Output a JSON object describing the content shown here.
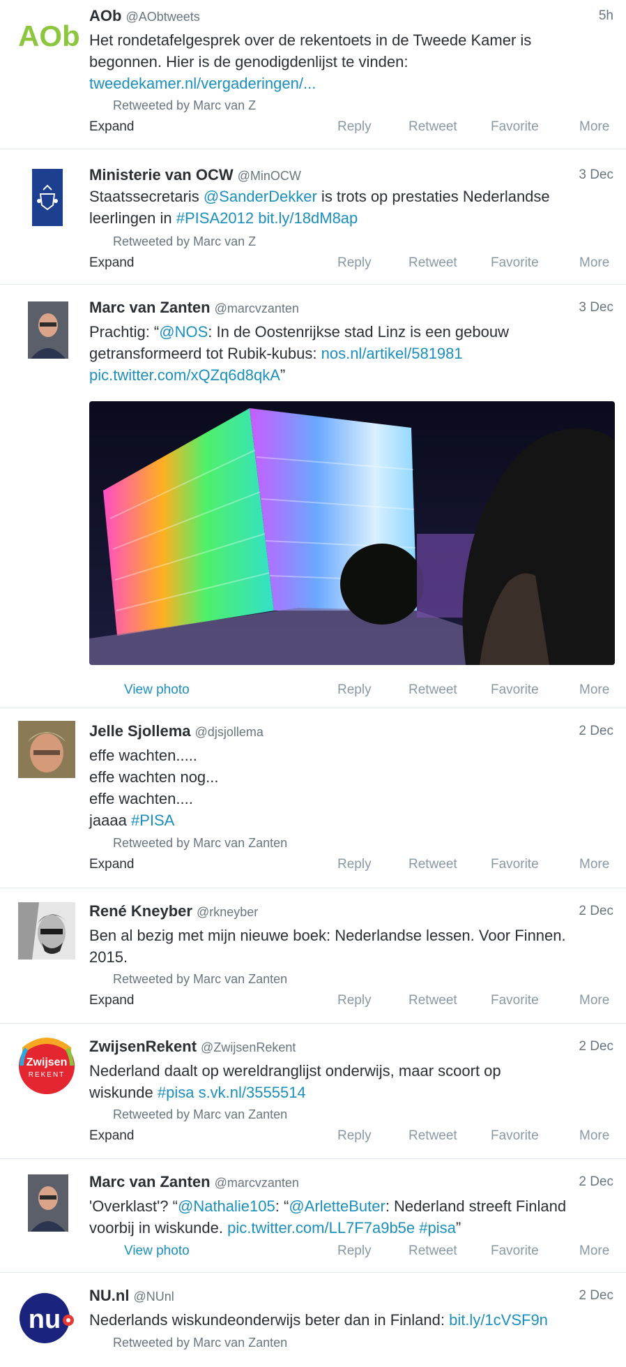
{
  "actions": {
    "expand": "Expand",
    "reply": "Reply",
    "retweet": "Retweet",
    "favorite": "Favorite",
    "more": "More",
    "view_photo": "View photo"
  },
  "tweets": [
    {
      "name": "AOb",
      "handle": "@AObtweets",
      "time": "5h",
      "text": [
        "Het rondetafelgesprek over de rekentoets in de Tweede Kamer is",
        "begonnen. Hier is de genodigdenlijst te vinden:"
      ],
      "link": "tweedekamer.nl/vergaderingen/...",
      "retweeted_by": "Retweeted by Marc van Z"
    },
    {
      "name": "Ministerie van OCW",
      "handle": "@MinOCW",
      "time": "3 Dec",
      "text1": "Staatssecretaris ",
      "mention": "@SanderDekker",
      "text2": " is trots op prestaties Nederlandse",
      "text3": "leerlingen in ",
      "hashtag": "#PISA2012",
      "link": "bit.ly/18dM8ap",
      "retweeted_by": "Retweeted by Marc van Z"
    },
    {
      "name": "Marc van Zanten",
      "handle": "@marcvzanten",
      "time": "3 Dec",
      "text1": "Prachtig: “",
      "mention": "@NOS",
      "text2": ": In de Oostenrijkse stad Linz is een gebouw",
      "text3": "getransformeerd tot Rubik-kubus: ",
      "link": "nos.nl/artikel/581981",
      "link2": "pic.twitter.com/xQZq6d8qkA",
      "text4": "”"
    },
    {
      "name": "Jelle Sjollema",
      "handle": "@djsjollema",
      "time": "2 Dec",
      "lines": [
        "effe wachten.....",
        "effe wachten nog...",
        "effe wachten...."
      ],
      "text1": "jaaaa ",
      "hashtag": "#PISA",
      "retweeted_by": "Retweeted by Marc van Zanten"
    },
    {
      "name": "René Kneyber",
      "handle": "@rkneyber",
      "time": "2 Dec",
      "lines": [
        "Ben al bezig met mijn nieuwe boek: Nederlandse lessen. Voor Finnen.",
        "2015."
      ],
      "retweeted_by": "Retweeted by Marc van Zanten"
    },
    {
      "name": "ZwijsenRekent",
      "handle": "@ZwijsenRekent",
      "time": "2 Dec",
      "text1": "Nederland daalt op wereldranglijst onderwijs, maar scoort op",
      "text2": "wiskunde ",
      "hashtag": "#pisa",
      "link": "s.vk.nl/3555514",
      "retweeted_by": "Retweeted by Marc van Zanten",
      "logo_top": "Zwijsen",
      "logo_bottom": "REKENT"
    },
    {
      "name": "Marc van Zanten",
      "handle": "@marcvzanten",
      "time": "2 Dec",
      "text1": "'Overklast'? “",
      "mention": "@Nathalie105",
      "text2": ": “",
      "mention2": "@ArletteButer",
      "text3": ": Nederland streeft Finland",
      "text4": "voorbij in wiskunde. ",
      "link": "pic.twitter.com/LL7F7a9b5e",
      "hashtag": "#pisa",
      "text5": "”"
    },
    {
      "name": "NU.nl",
      "handle": "@NUnl",
      "time": "2 Dec",
      "text1": "Nederlands wiskundeonderwijs beter dan in Finland: ",
      "link": "bit.ly/1cVSF9n",
      "retweeted_by": "Retweeted by Marc van Zanten",
      "logo": "nu"
    }
  ]
}
